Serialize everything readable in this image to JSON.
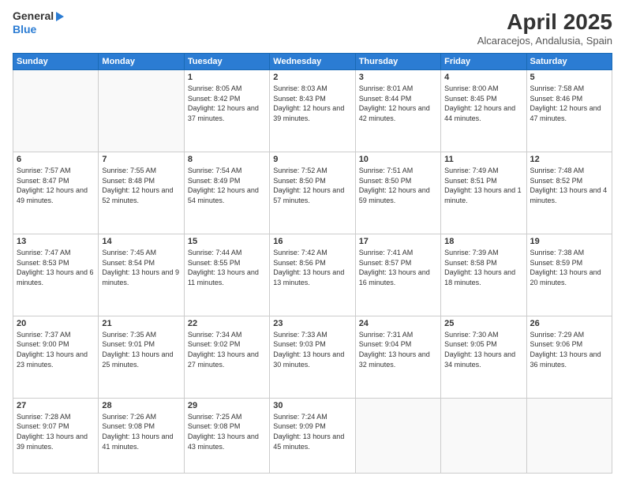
{
  "header": {
    "logo_line1": "General",
    "logo_line2": "Blue",
    "title": "April 2025",
    "subtitle": "Alcaracejos, Andalusia, Spain"
  },
  "days_of_week": [
    "Sunday",
    "Monday",
    "Tuesday",
    "Wednesday",
    "Thursday",
    "Friday",
    "Saturday"
  ],
  "weeks": [
    [
      {
        "day": "",
        "info": ""
      },
      {
        "day": "",
        "info": ""
      },
      {
        "day": "1",
        "info": "Sunrise: 8:05 AM\nSunset: 8:42 PM\nDaylight: 12 hours and 37 minutes."
      },
      {
        "day": "2",
        "info": "Sunrise: 8:03 AM\nSunset: 8:43 PM\nDaylight: 12 hours and 39 minutes."
      },
      {
        "day": "3",
        "info": "Sunrise: 8:01 AM\nSunset: 8:44 PM\nDaylight: 12 hours and 42 minutes."
      },
      {
        "day": "4",
        "info": "Sunrise: 8:00 AM\nSunset: 8:45 PM\nDaylight: 12 hours and 44 minutes."
      },
      {
        "day": "5",
        "info": "Sunrise: 7:58 AM\nSunset: 8:46 PM\nDaylight: 12 hours and 47 minutes."
      }
    ],
    [
      {
        "day": "6",
        "info": "Sunrise: 7:57 AM\nSunset: 8:47 PM\nDaylight: 12 hours and 49 minutes."
      },
      {
        "day": "7",
        "info": "Sunrise: 7:55 AM\nSunset: 8:48 PM\nDaylight: 12 hours and 52 minutes."
      },
      {
        "day": "8",
        "info": "Sunrise: 7:54 AM\nSunset: 8:49 PM\nDaylight: 12 hours and 54 minutes."
      },
      {
        "day": "9",
        "info": "Sunrise: 7:52 AM\nSunset: 8:50 PM\nDaylight: 12 hours and 57 minutes."
      },
      {
        "day": "10",
        "info": "Sunrise: 7:51 AM\nSunset: 8:50 PM\nDaylight: 12 hours and 59 minutes."
      },
      {
        "day": "11",
        "info": "Sunrise: 7:49 AM\nSunset: 8:51 PM\nDaylight: 13 hours and 1 minute."
      },
      {
        "day": "12",
        "info": "Sunrise: 7:48 AM\nSunset: 8:52 PM\nDaylight: 13 hours and 4 minutes."
      }
    ],
    [
      {
        "day": "13",
        "info": "Sunrise: 7:47 AM\nSunset: 8:53 PM\nDaylight: 13 hours and 6 minutes."
      },
      {
        "day": "14",
        "info": "Sunrise: 7:45 AM\nSunset: 8:54 PM\nDaylight: 13 hours and 9 minutes."
      },
      {
        "day": "15",
        "info": "Sunrise: 7:44 AM\nSunset: 8:55 PM\nDaylight: 13 hours and 11 minutes."
      },
      {
        "day": "16",
        "info": "Sunrise: 7:42 AM\nSunset: 8:56 PM\nDaylight: 13 hours and 13 minutes."
      },
      {
        "day": "17",
        "info": "Sunrise: 7:41 AM\nSunset: 8:57 PM\nDaylight: 13 hours and 16 minutes."
      },
      {
        "day": "18",
        "info": "Sunrise: 7:39 AM\nSunset: 8:58 PM\nDaylight: 13 hours and 18 minutes."
      },
      {
        "day": "19",
        "info": "Sunrise: 7:38 AM\nSunset: 8:59 PM\nDaylight: 13 hours and 20 minutes."
      }
    ],
    [
      {
        "day": "20",
        "info": "Sunrise: 7:37 AM\nSunset: 9:00 PM\nDaylight: 13 hours and 23 minutes."
      },
      {
        "day": "21",
        "info": "Sunrise: 7:35 AM\nSunset: 9:01 PM\nDaylight: 13 hours and 25 minutes."
      },
      {
        "day": "22",
        "info": "Sunrise: 7:34 AM\nSunset: 9:02 PM\nDaylight: 13 hours and 27 minutes."
      },
      {
        "day": "23",
        "info": "Sunrise: 7:33 AM\nSunset: 9:03 PM\nDaylight: 13 hours and 30 minutes."
      },
      {
        "day": "24",
        "info": "Sunrise: 7:31 AM\nSunset: 9:04 PM\nDaylight: 13 hours and 32 minutes."
      },
      {
        "day": "25",
        "info": "Sunrise: 7:30 AM\nSunset: 9:05 PM\nDaylight: 13 hours and 34 minutes."
      },
      {
        "day": "26",
        "info": "Sunrise: 7:29 AM\nSunset: 9:06 PM\nDaylight: 13 hours and 36 minutes."
      }
    ],
    [
      {
        "day": "27",
        "info": "Sunrise: 7:28 AM\nSunset: 9:07 PM\nDaylight: 13 hours and 39 minutes."
      },
      {
        "day": "28",
        "info": "Sunrise: 7:26 AM\nSunset: 9:08 PM\nDaylight: 13 hours and 41 minutes."
      },
      {
        "day": "29",
        "info": "Sunrise: 7:25 AM\nSunset: 9:08 PM\nDaylight: 13 hours and 43 minutes."
      },
      {
        "day": "30",
        "info": "Sunrise: 7:24 AM\nSunset: 9:09 PM\nDaylight: 13 hours and 45 minutes."
      },
      {
        "day": "",
        "info": ""
      },
      {
        "day": "",
        "info": ""
      },
      {
        "day": "",
        "info": ""
      }
    ]
  ]
}
